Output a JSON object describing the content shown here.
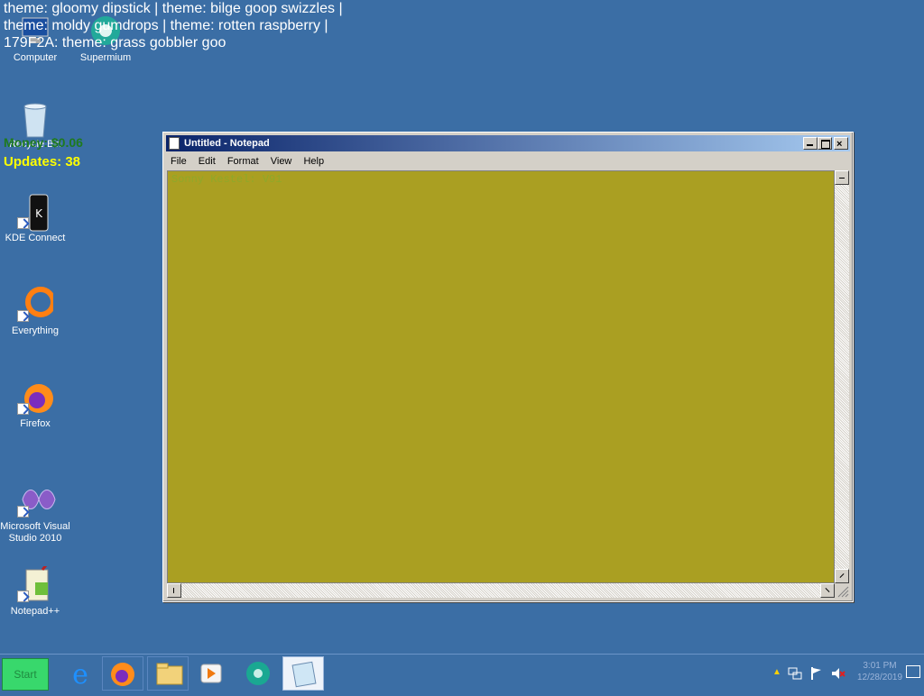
{
  "overlay": {
    "theme_text": "theme: gloomy dipstick | theme: bilge goop swizzles | theme: moldy gumdrops | theme: rotten raspberry | 179F2A: theme: grass gobbler goo",
    "money": "Money: $0.06",
    "updates": "Updates: 38"
  },
  "desktop_icons": [
    {
      "label": "Computer"
    },
    {
      "label": "Supermium"
    },
    {
      "label": "Recycle Bin"
    },
    {
      "label": "KDE Connect"
    },
    {
      "label": "Everything"
    },
    {
      "label": "Firefox"
    },
    {
      "label": "Microsoft Visual Studio 2010"
    },
    {
      "label": "Notepad++"
    }
  ],
  "notepad": {
    "title": "Untitled - Notepad",
    "menu": [
      "File",
      "Edit",
      "Format",
      "View",
      "Help"
    ],
    "content": "Sonny Kestel: V91"
  },
  "taskbar": {
    "start_label": "Start",
    "clock_time": "3:01 PM",
    "clock_date": "12/28/2019"
  },
  "colors": {
    "desktop": "#3b6ea5",
    "editor_bg": "#aa9f22",
    "editor_text": "#8fa82a",
    "start_button": "#38d86c"
  }
}
